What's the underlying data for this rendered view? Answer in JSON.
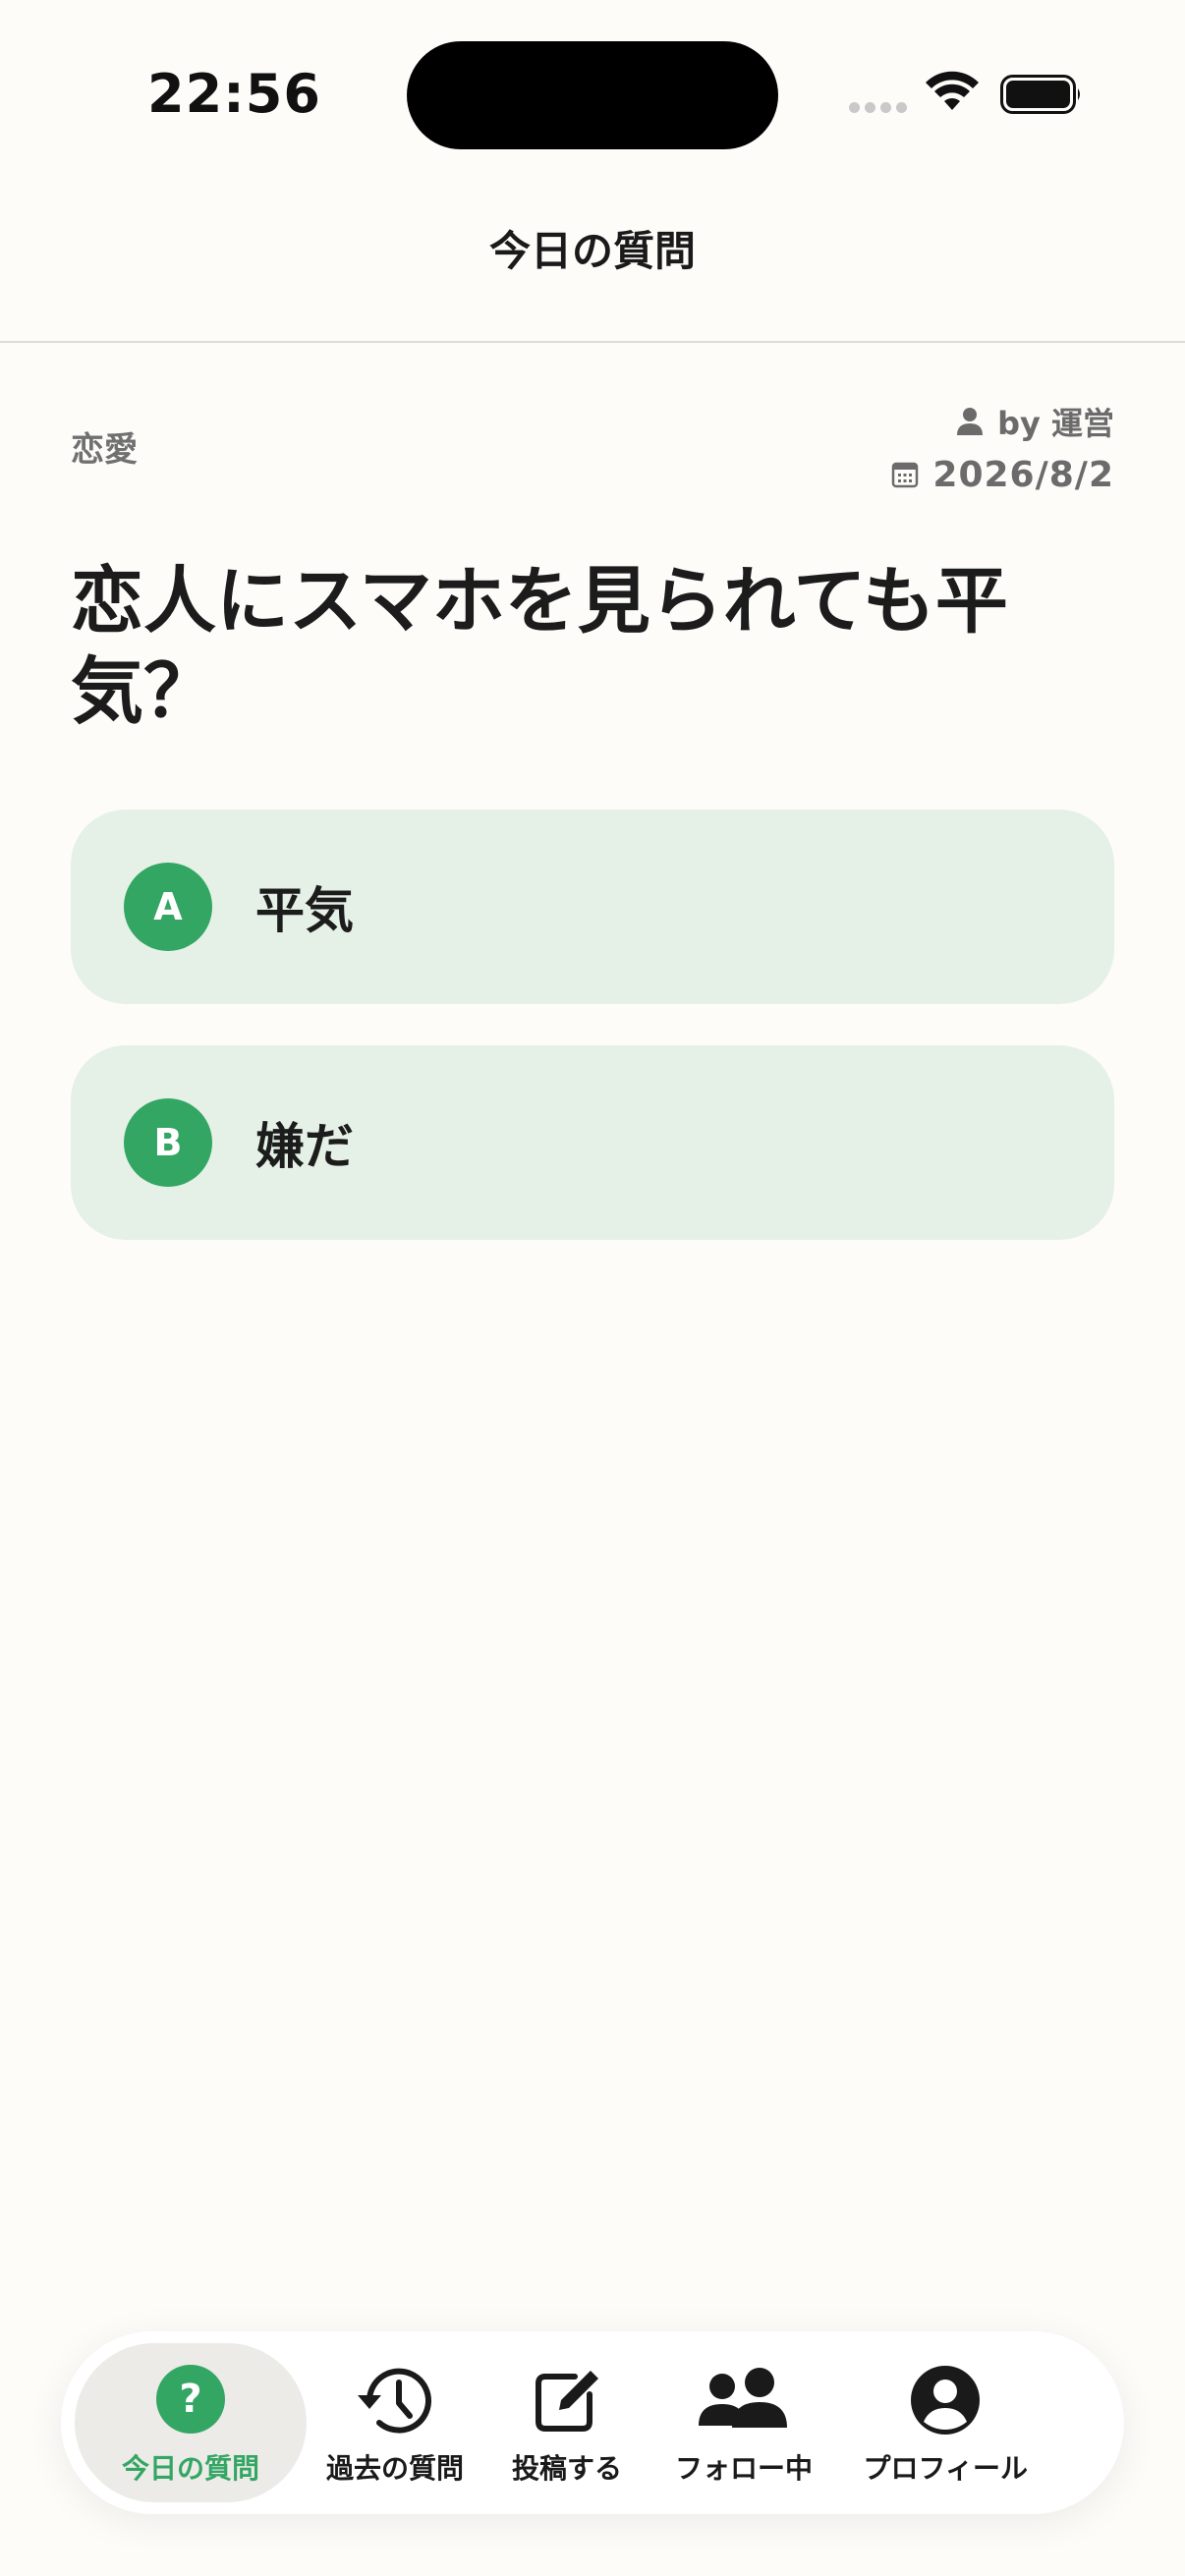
{
  "status_bar": {
    "time": "22:56"
  },
  "header": {
    "title": "今日の質問"
  },
  "question_card": {
    "category": "恋愛",
    "author": "by 運営",
    "date": "2026/8/2",
    "question": "恋人にスマホを見られても平気？",
    "options": [
      {
        "letter": "A",
        "label": "平気"
      },
      {
        "letter": "B",
        "label": "嫌だ"
      }
    ]
  },
  "colors": {
    "accent": "#33a664",
    "option_bg": "#e5f1e6",
    "background": "#fdfcf9"
  },
  "tab_bar": {
    "active": "today",
    "items": [
      {
        "id": "today",
        "label": "今日の質問",
        "icon": "question-circle-icon"
      },
      {
        "id": "history",
        "label": "過去の質問",
        "icon": "history-icon"
      },
      {
        "id": "post",
        "label": "投稿する",
        "icon": "compose-icon"
      },
      {
        "id": "following",
        "label": "フォロー中",
        "icon": "people-icon"
      },
      {
        "id": "profile",
        "label": "プロフィール",
        "icon": "profile-icon"
      }
    ]
  }
}
